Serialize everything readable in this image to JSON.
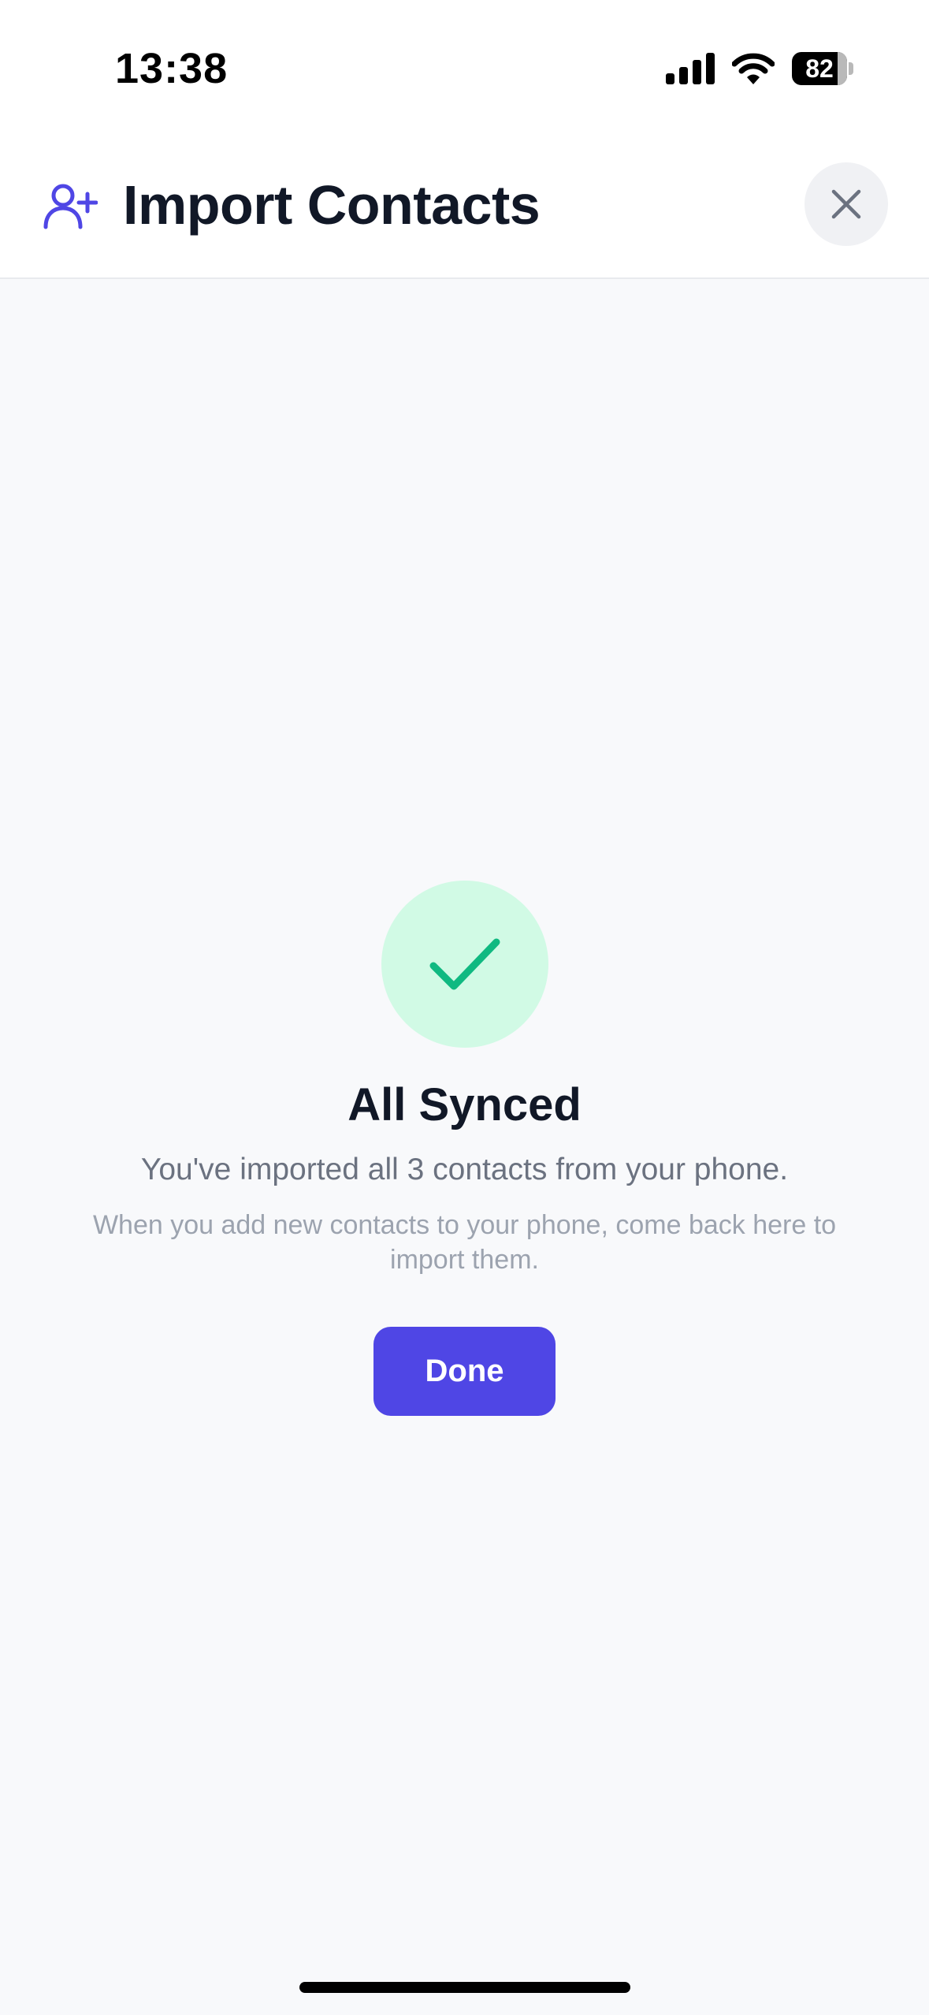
{
  "status_bar": {
    "time": "13:38",
    "battery_level": "82",
    "icons": [
      "signal-icon",
      "wifi-icon",
      "battery-icon"
    ]
  },
  "header": {
    "icon": "user-plus-icon",
    "title": "Import Contacts",
    "close_icon": "close-icon"
  },
  "main": {
    "status_icon": "check-icon",
    "title": "All Synced",
    "subtitle": "You've imported all 3 contacts from your phone.",
    "hint": "When you add new contacts to your phone, come back here to import them.",
    "done_label": "Done"
  },
  "colors": {
    "accent": "#4f46e5",
    "success": "#10b981",
    "success_bg": "#d1fae5",
    "background": "#f8f9fb",
    "title": "#111827",
    "subtitle": "#6b7280",
    "hint": "#9ca3af"
  }
}
